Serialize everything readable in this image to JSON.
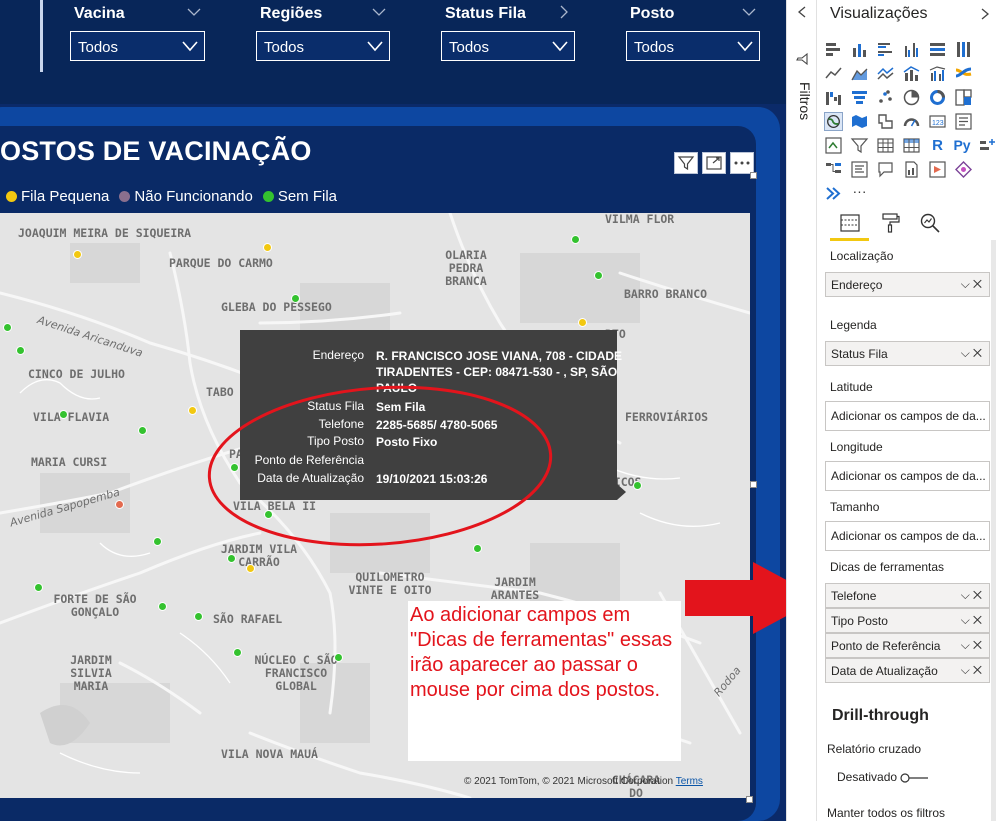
{
  "slicers": [
    {
      "title": "Vacina",
      "value": "Todos"
    },
    {
      "title": "Regiões",
      "value": "Todos"
    },
    {
      "title": "Status Fila",
      "value": "Todos"
    },
    {
      "title": "Posto",
      "value": "Todos"
    }
  ],
  "visual": {
    "title": "OSTOS DE VACINAÇÃO",
    "legend": [
      {
        "label": "Fila Pequena",
        "color": "#f2c811"
      },
      {
        "label": "Não Funcionando",
        "color": "#8a6f8e"
      },
      {
        "label": "Sem Fila",
        "color": "#34c22f"
      }
    ],
    "header_icons": [
      "filter-icon",
      "focus-mode-icon",
      "more-options-icon"
    ]
  },
  "map": {
    "places": [
      "JOAQUIM MEIRA DE SIQUEIRA",
      "PARQUE DO CARMO",
      "OLARIA PEDRA BRANCA",
      "VILMA FLOR",
      "GLEBA DO PÊSSEGO",
      "BARRO BRANCO",
      "CINCO DE JULHO",
      "TABO",
      "VILA FLAVIA",
      "FERROVIÁRIOS",
      "MARIA CURSI",
      "VILA BELA II",
      "JARDIM VILA CARRÃO",
      "QUILOMETRO VINTE E OITO",
      "JARDIM ARANTES",
      "FORTE DE SÃO GONÇALO",
      "SÃO RAFAEL",
      "JARDIM SILVIA MARIA",
      "NÚCLEO C SÃO FRANCISCO GLOBAL",
      "VILA NOVA MAUÁ",
      "CHÁCARA DO CARNEIRO",
      "RTO",
      "GÁFICOS",
      "PA",
      "Avenida Aricanduva",
      "Avenida Sapopemba",
      "Rodoa"
    ],
    "attribution": "© 2021 TomTom, © 2021 Microsoft Corporation",
    "terms": "Terms"
  },
  "tooltip": {
    "rows": [
      {
        "key": "Endereço",
        "value": [
          "R. FRANCISCO JOSE VIANA, 708 - CIDADE",
          "TIRADENTES - CEP: 08471-530 - , SP, SÃO",
          "PAULO"
        ]
      },
      {
        "key": "Status Fila",
        "value": [
          "Sem Fila"
        ]
      },
      {
        "key": "Telefone",
        "value": [
          "2285-5685/ 4780-5065"
        ]
      },
      {
        "key": "Tipo Posto",
        "value": [
          "Posto Fixo"
        ]
      },
      {
        "key": "Ponto de Referência",
        "value": [
          ""
        ]
      },
      {
        "key": "Data de Atualização",
        "value": [
          "19/10/2021 15:03:26"
        ]
      }
    ]
  },
  "annotation": {
    "text": "Ao adicionar campos em \"Dicas de ferramentas\" essas irão aparecer ao passar o mouse por cima dos postos.",
    "color": "#e3141c"
  },
  "filters_pane": {
    "label": "Filtros"
  },
  "viz_pane": {
    "title": "Visualizações",
    "sections": {
      "localizacao": {
        "label": "Localização",
        "fields": [
          "Endereço"
        ]
      },
      "legenda": {
        "label": "Legenda",
        "fields": [
          "Status Fila"
        ]
      },
      "latitude": {
        "label": "Latitude",
        "placeholder": "Adicionar os campos de da..."
      },
      "longitude": {
        "label": "Longitude",
        "placeholder": "Adicionar os campos de da..."
      },
      "tamanho": {
        "label": "Tamanho",
        "placeholder": "Adicionar os campos de da..."
      },
      "dicas": {
        "label": "Dicas de ferramentas",
        "fields": [
          "Telefone",
          "Tipo Posto",
          "Ponto de Referência",
          "Data de Atualização"
        ]
      }
    },
    "drill": {
      "title": "Drill-through",
      "cross_report": "Relatório cruzado",
      "toggle_state": "Desativado",
      "keep_filters": "Manter todos os filtros"
    }
  }
}
